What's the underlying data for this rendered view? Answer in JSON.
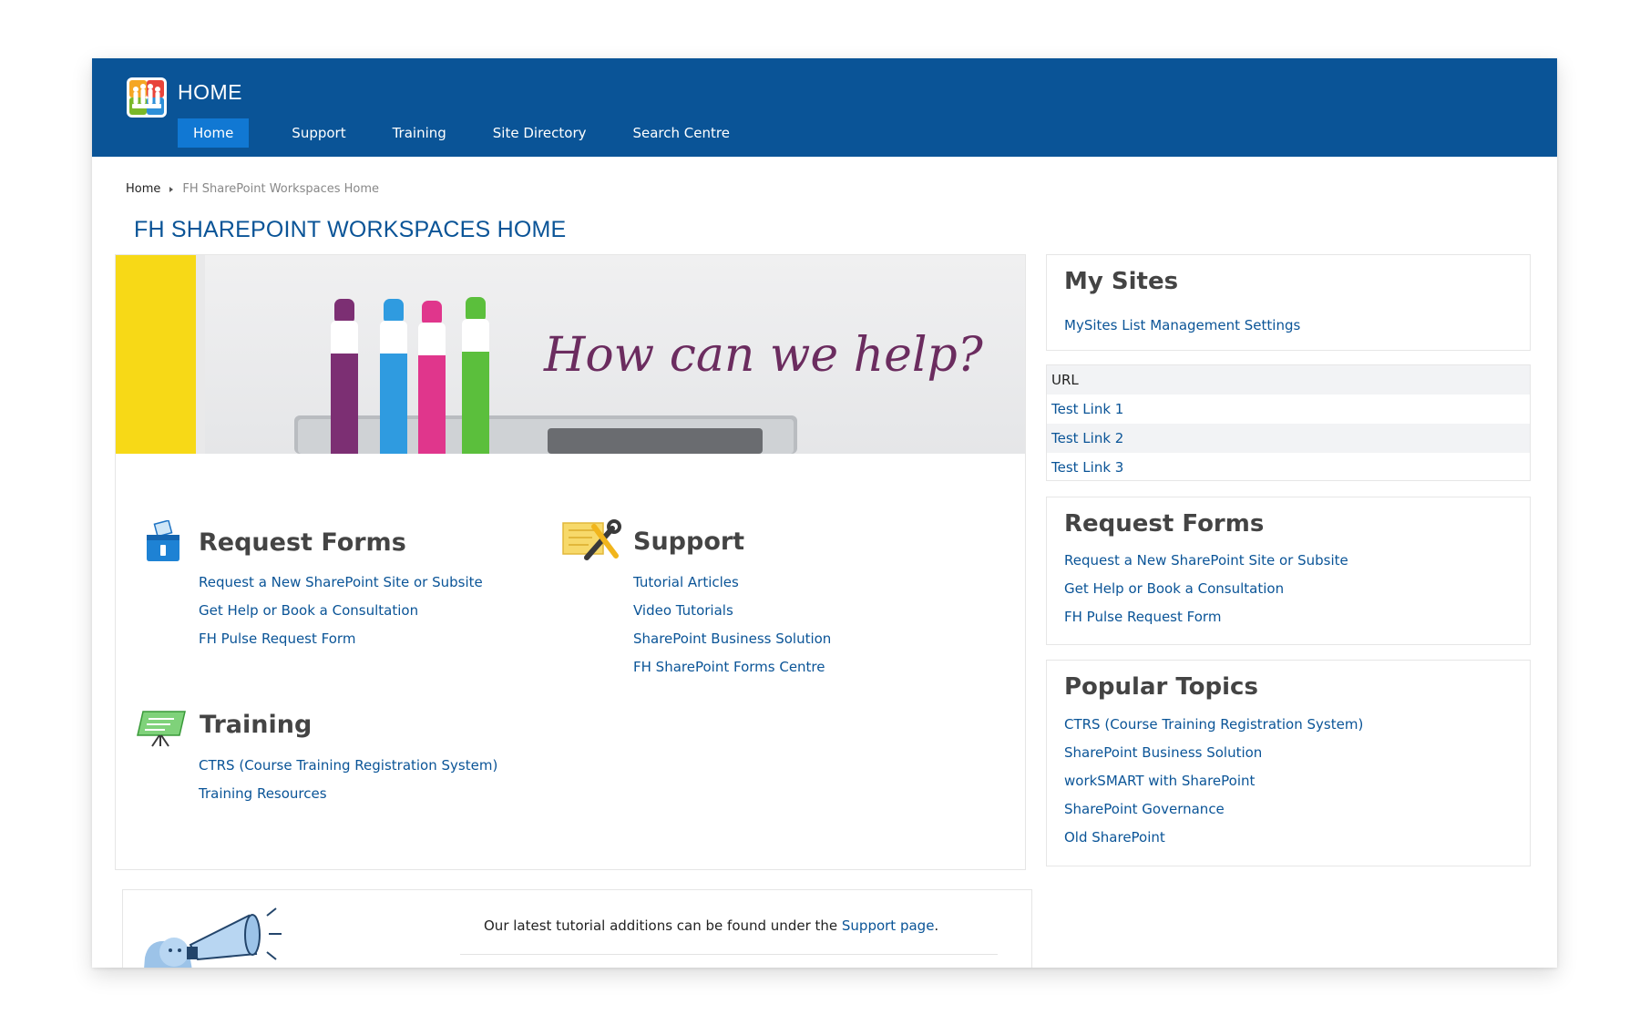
{
  "header": {
    "title": "HOME",
    "nav": [
      {
        "label": "Home",
        "active": true
      },
      {
        "label": "Support",
        "active": false
      },
      {
        "label": "Training",
        "active": false
      },
      {
        "label": "Site Directory",
        "active": false
      },
      {
        "label": "Search Centre",
        "active": false
      }
    ]
  },
  "breadcrumb": {
    "root": "Home",
    "current": "FH SharePoint Workspaces Home"
  },
  "page_title": "FH SHAREPOINT WORKSPACES HOME",
  "hero": {
    "text": "How can we help?"
  },
  "sections": {
    "request_forms": {
      "title": "Request Forms",
      "icon": "ballot-box-icon",
      "links": [
        "Request a New SharePoint Site or Subsite",
        "Get Help or Book a Consultation",
        "FH Pulse Request Form"
      ]
    },
    "support": {
      "title": "Support",
      "icon": "tools-icon",
      "links": [
        "Tutorial Articles",
        "Video Tutorials",
        "SharePoint Business Solution",
        "FH SharePoint Forms Centre"
      ]
    },
    "training": {
      "title": "Training",
      "icon": "presentation-board-icon",
      "links": [
        "CTRS (Course Training Registration System)",
        "Training Resources"
      ]
    }
  },
  "sidebar": {
    "my_sites": {
      "title": "My Sites",
      "link": "MySites List Management Settings"
    },
    "url_table": {
      "header": "URL",
      "rows": [
        "Test Link 1",
        "Test Link 2",
        "Test Link 3"
      ]
    },
    "request_forms": {
      "title": "Request Forms",
      "links": [
        "Request a New SharePoint Site or Subsite",
        "Get Help or Book a Consultation",
        "FH Pulse Request Form"
      ]
    },
    "popular_topics": {
      "title": "Popular Topics",
      "links": [
        "CTRS (Course Training Registration System)",
        "SharePoint Business Solution",
        "workSMART with SharePoint",
        "SharePoint Governance",
        "Old SharePoint"
      ]
    }
  },
  "announcement": {
    "text_before": "Our latest tutorial additions can be found under the ",
    "link": "Support page",
    "text_after": "."
  },
  "colors": {
    "brand_blue": "#0a5497",
    "nav_active": "#1178d3",
    "link": "#0a5497",
    "heading": "#444444"
  }
}
